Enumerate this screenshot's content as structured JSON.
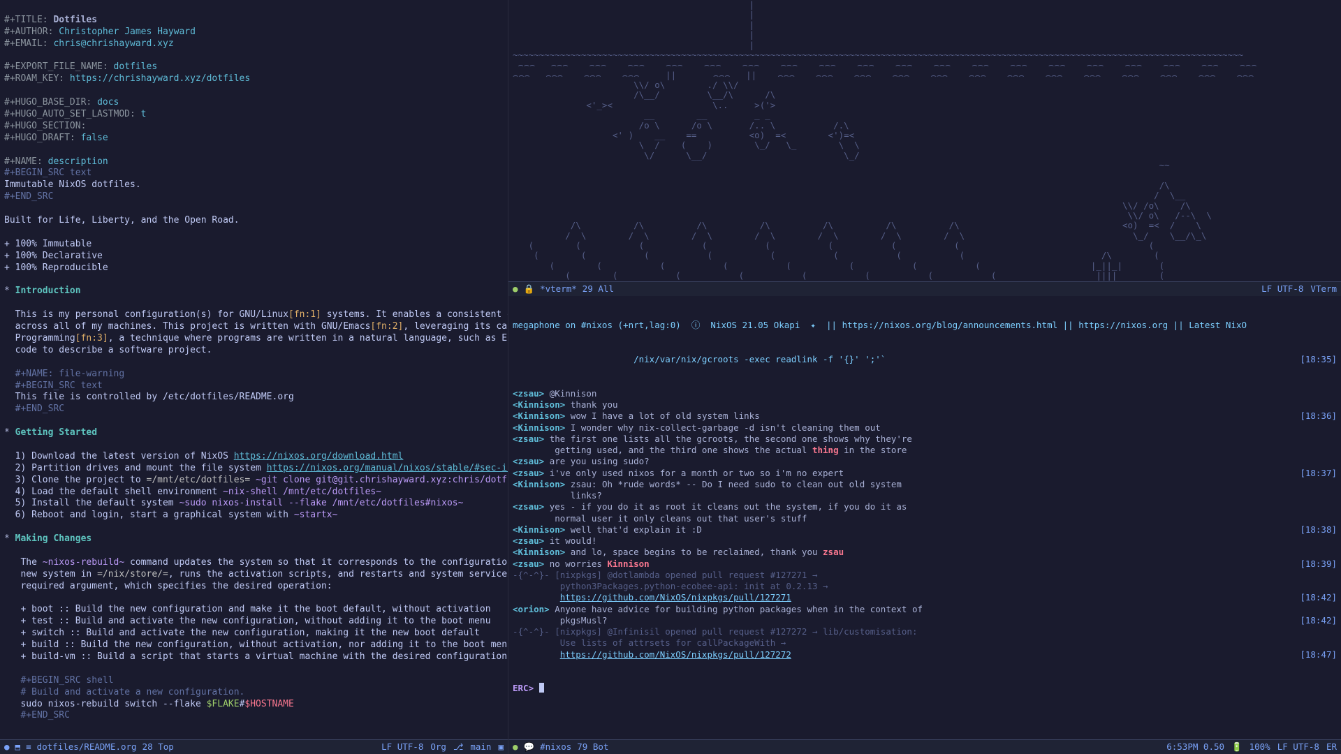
{
  "left": {
    "meta": {
      "title_kw": "#+TITLE:",
      "title_val": "Dotfiles",
      "author_kw": "#+AUTHOR:",
      "author_val": "Christopher James Hayward",
      "email_kw": "#+EMAIL:",
      "email_val": "chris@chrishayward.xyz",
      "export_kw": "#+EXPORT_FILE_NAME:",
      "export_val": "dotfiles",
      "roamkey_kw": "#+ROAM_KEY:",
      "roamkey_val": "https://chrishayward.xyz/dotfiles",
      "hugo_base_kw": "#+HUGO_BASE_DIR:",
      "hugo_base_val": "docs",
      "hugo_lastmod_kw": "#+HUGO_AUTO_SET_LASTMOD:",
      "hugo_lastmod_val": "t",
      "hugo_section_kw": "#+HUGO_SECTION:",
      "hugo_draft_kw": "#+HUGO_DRAFT:",
      "hugo_draft_val": "false",
      "name_desc_kw": "#+NAME:",
      "name_desc_val": "description",
      "begin_text": "#+BEGIN_SRC text",
      "end_src": "#+END_SRC",
      "desc_text": "Immutable NixOS dotfiles.",
      "tagline": "Built for Life, Liberty, and the Open Road.",
      "feat1": "+ 100% Immutable",
      "feat2": "+ 100% Declarative",
      "feat3": "+ 100% Reproducible"
    },
    "intro": {
      "star": "*",
      "heading": "Introduction",
      "p1a": "This is my personal configuration(s) for GNU/Linux",
      "fn1": "[fn:1]",
      "p1b": " systems. It enables a consistent experience and computing environment",
      "p2a": "across all of my machines. This project is written with GNU/Emacs",
      "fn2": "[fn:2]",
      "p2b": ", leveraging its capabilities for Literate",
      "p3a": "Programming",
      "fn3": "[fn:3]",
      "p3b": ", a technique where programs are written in a natural language, such as English, interspersed with snippets of",
      "p4": "code to describe a software project.",
      "name_warn": "#+NAME: file-warning",
      "warn_text": "This file is controlled by /etc/dotfiles/README.org"
    },
    "gs": {
      "heading": "Getting Started",
      "l1a": "1) Download the latest version of NixOS ",
      "l1_link": "https://nixos.org/download.html",
      "l2a": "2) Partition drives and mount the file system ",
      "l2_link": "https://nixos.org/manual/nixos/stable/#sec-installation-partitioning",
      "l3a": "3) Clone the project to ",
      "l3_code1": "=/mnt/etc/dotfiles=",
      "l3_space": " ",
      "l3_cmd": "~git clone git@git.chrishayward.xyz:chris/dotfiles /mnt/etc/dotfiles~",
      "l4a": "4) Load the default shell environment ",
      "l4_cmd": "~nix-shell /mnt/etc/dotfiles~",
      "l5a": "5) Install the default system ",
      "l5_cmd": "~sudo nixos-install --flake /mnt/etc/dotfiles#nixos~",
      "l6a": "6) Reboot and login, start a graphical system with ",
      "l6_cmd": "~startx~"
    },
    "mc": {
      "heading": "Making Changes",
      "p1a": "The ",
      "p1_cmd": "~nixos-rebuild~",
      "p1b": " command updates the system so that it corresponds to the configuration specified in the module. It builds the",
      "p2a": "new system in ",
      "p2_code": "=/nix/store/=",
      "p2b": ", runs the activation scripts, and restarts and system services (if needed). The command has one",
      "p3": "required argument, which specifies the desired operation:",
      "i1": "+ boot :: Build the new configuration and make it the boot default, without activation",
      "i2": "+ test :: Build and activate the new configuration, without adding it to the boot menu",
      "i3": "+ switch :: Build and activate the new configuration, making it the new boot default",
      "i4": "+ build :: Build the new configuration, without activation, nor adding it to the boot menu",
      "i5": "+ build-vm :: Build a script that starts a virtual machine with the desired configuration",
      "begin_shell": "#+BEGIN_SRC shell",
      "comment": "# Build and activate a new configuration.",
      "sudo_pre": "sudo nixos-rebuild switch --flake ",
      "flake": "$FLAKE",
      "hash": "#",
      "hostname": "$HOSTNAME"
    }
  },
  "left_modeline": {
    "circle_icon": "●",
    "save_icon": "⬒",
    "file_icon": "≡",
    "filename": "dotfiles/README.org",
    "pos": "28 Top",
    "enc": "LF UTF-8",
    "mode": "Org",
    "branch_icon": "⎇",
    "branch": "main",
    "right_icon": "▣"
  },
  "vterm": {
    "ascii": "                                             |\n                                             |\n                                             |\n                                             |\n                                             |\n~~~~~~~~~~~~~~~~~~~~~~~~~~~~~~~~~~~~~~~~~~~~~~~~~~~~~~~~~~~~~~~~~~~~~~~~~~~~~~~~~~~~~~~~~~~~~~~~~~~~~~~~~~~~~~~~~~~~~~~~~~~~~~~~~~~~~~~~~~~\n ⌢⌢⌢   ⌢⌢⌢    ⌢⌢⌢    ⌢⌢⌢    ⌢⌢⌢    ⌢⌢⌢    ⌢⌢⌢    ⌢⌢⌢    ⌢⌢⌢    ⌢⌢⌢    ⌢⌢⌢    ⌢⌢⌢    ⌢⌢⌢    ⌢⌢⌢    ⌢⌢⌢    ⌢⌢⌢    ⌢⌢⌢    ⌢⌢⌢    ⌢⌢⌢    ⌢⌢⌢\n⌢⌢⌢   ⌢⌢⌢    ⌢⌢⌢    ⌢⌢⌢     ||       ⌢⌢⌢   ||    ⌢⌢⌢    ⌢⌢⌢    ⌢⌢⌢    ⌢⌢⌢    ⌢⌢⌢    ⌢⌢⌢    ⌢⌢⌢    ⌢⌢⌢    ⌢⌢⌢    ⌢⌢⌢    ⌢⌢⌢    ⌢⌢⌢    ⌢⌢⌢\n                       \\\\/ o\\        ./ \\\\/\n                       /\\__/         \\__/\\      /\\\n              <'_><                   \\..     >('>\n                         __        __         _ _\n                        /o \\      /o \\       /.. \\           /.\\\n                   <' )    __    ==          <o)  =<        <')=<\n                        \\  /    (    )        \\_/   \\_        \\  \\\n                         \\/      \\__/                          \\_/\n                                                                                                                           ~~\n\n                                                                                                                           /\\\n                                                                                                                          /  \\__\n                                                                                                                    \\\\/ /o\\    /\\\n                                                                                                                     \\\\/ o\\   /--\\  \\\n           /\\          /\\          /\\          /\\          /\\          /\\          /\\                               <o)  =<  /    \\\n          /  \\        /  \\        /  \\        /  \\        /  \\        /  \\        /  \\                                \\_/    \\__/\\_\\\n   (        (           (           (           (           (           (           (                                    (\n    (        (           (           (           (           (           (           (                          /\\        (\n       (        (           (           (           (           (           (           (                     |_||_|       (\n          (        (           (           (           (           (           (           (                   ||||        (",
    "modeline": {
      "circle": "●",
      "lock": "🔒",
      "buf": "*vterm*",
      "pos": "29 All",
      "enc": "LF UTF-8",
      "mode": "VTerm"
    }
  },
  "irc": {
    "topic1": "megaphone on #nixos (+nrt,lag:0)  ⓘ  NixOS 21.05 Okapi  ✦  || https://nixos.org/blog/announcements.html || https://nixos.org || Latest NixO",
    "topic2": "                       /nix/var/nix/gcroots -exec readlink -f '{}' ';'`",
    "ts0": "[18:35]",
    "lines": [
      {
        "nick": "<zsau>",
        "msg": "@Kinnison",
        "ts": ""
      },
      {
        "nick": "<Kinnison>",
        "msg": "thank you",
        "ts": ""
      },
      {
        "nick": "<Kinnison>",
        "msg": "wow I have a lot of old system links",
        "ts": "[18:36]"
      },
      {
        "nick": "<Kinnison>",
        "msg": "I wonder why nix-collect-garbage -d isn't cleaning them out",
        "ts": ""
      },
      {
        "nick": "<zsau>",
        "msg": "the first one lists all the gcroots, the second one shows why they're",
        "ts": ""
      },
      {
        "nick": "",
        "msg": "        getting used, and the third one shows the actual thing in the store",
        "ts": "",
        "hi": "thing"
      },
      {
        "nick": "<zsau>",
        "msg": "are you using sudo?",
        "ts": ""
      },
      {
        "nick": "<zsau>",
        "msg": "i've only used nixos for a month or two so i'm no expert",
        "ts": "[18:37]"
      },
      {
        "nick": "<Kinnison>",
        "msg": "zsau: Oh *rude words* -- Do I need sudo to clean out old system",
        "ts": ""
      },
      {
        "nick": "",
        "msg": "           links?",
        "ts": ""
      },
      {
        "nick": "<zsau>",
        "msg": "yes - if you do it as root it cleans out the system, if you do it as",
        "ts": ""
      },
      {
        "nick": "",
        "msg": "        normal user it only cleans out that user's stuff",
        "ts": ""
      },
      {
        "nick": "<Kinnison>",
        "msg": "well that'd explain it :D",
        "ts": "[18:38]"
      },
      {
        "nick": "<zsau>",
        "msg": "it would!",
        "ts": ""
      },
      {
        "nick": "<Kinnison>",
        "msg": "and lo, space begins to be reclaimed, thank you zsau",
        "ts": "",
        "hi": "zsau"
      },
      {
        "nick": "<zsau>",
        "msg": "no worries Kinnison",
        "ts": "[18:39]",
        "hi": "Kinnison"
      },
      {
        "nick": "-{^-^}-",
        "msg": "[nixpkgs] @dotlambda opened pull request #127271 →",
        "ts": "",
        "bot": true
      },
      {
        "nick": "",
        "msg": "         python3Packages.python-ecobee-api: init at 0.2.13 →",
        "ts": "",
        "bot": true
      },
      {
        "nick": "",
        "msg": "",
        "url": "https://github.com/NixOS/nixpkgs/pull/127271",
        "ts": "[18:42]",
        "bot": true
      },
      {
        "nick": "<orion>",
        "msg": "Anyone have advice for building python packages when in the context of",
        "ts": ""
      },
      {
        "nick": "",
        "msg": "         pkgsMusl?",
        "ts": "[18:42]"
      },
      {
        "nick": "-{^-^}-",
        "msg": "[nixpkgs] @Infinisil opened pull request #127272 → lib/customisation:",
        "ts": "",
        "bot": true
      },
      {
        "nick": "",
        "msg": "         Use lists of attrsets for callPackageWith →",
        "ts": "",
        "bot": true
      },
      {
        "nick": "",
        "msg": "",
        "url": "https://github.com/NixOS/nixpkgs/pull/127272",
        "ts": "[18:47]",
        "bot": true
      }
    ],
    "prompt": "ERC>",
    "modeline": {
      "circle": "●",
      "chat": "💬",
      "buf": "#nixos",
      "pos": "79 Bot",
      "time": "6:53PM 0.50",
      "bat_icon": "🔋",
      "bat": "100%",
      "enc": "LF UTF-8",
      "mode": "ER"
    }
  }
}
